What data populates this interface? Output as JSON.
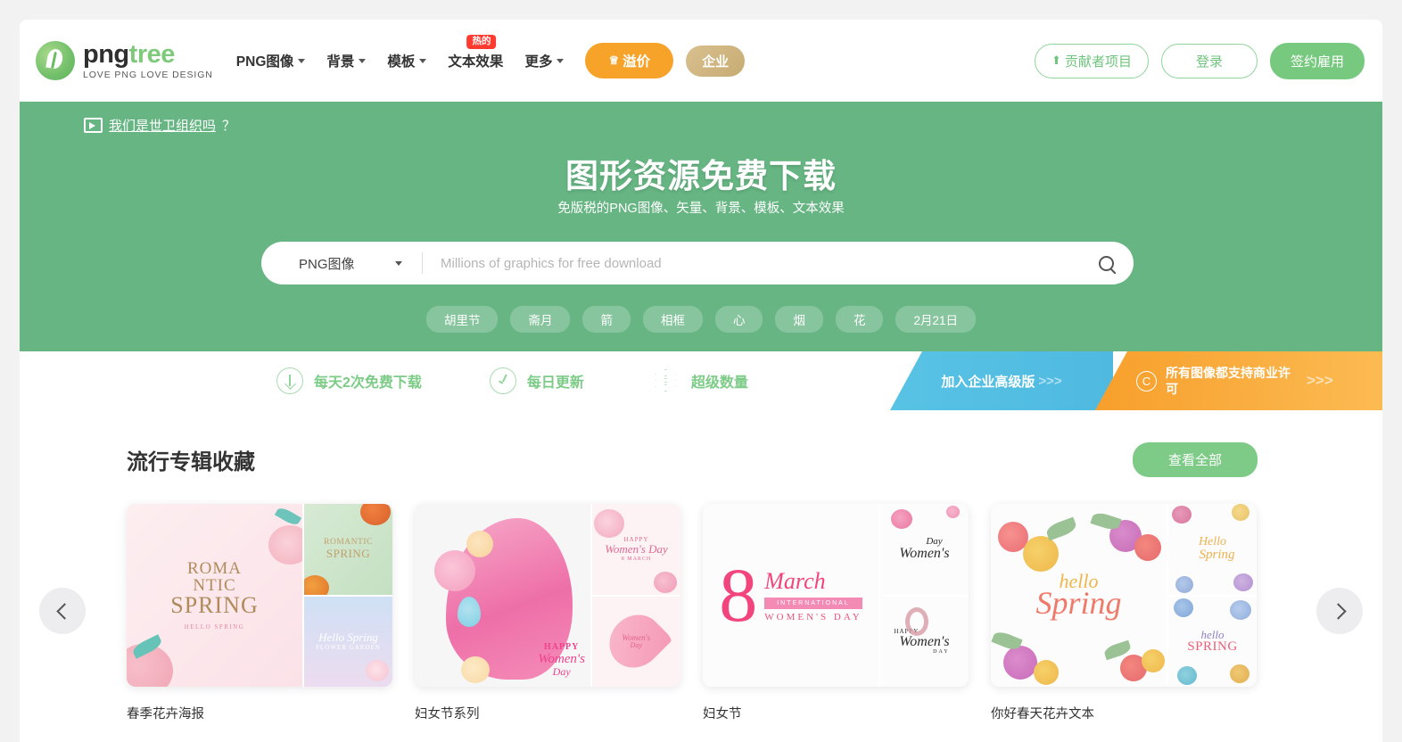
{
  "navbar": {
    "logo": {
      "png": "png",
      "tree": "tree",
      "tagline": "LOVE PNG LOVE DESIGN"
    },
    "items": [
      {
        "label": "PNG图像",
        "has_caret": true
      },
      {
        "label": "背景",
        "has_caret": true
      },
      {
        "label": "模板",
        "has_caret": true
      },
      {
        "label": "文本效果",
        "has_caret": false,
        "badge": "热的"
      },
      {
        "label": "更多",
        "has_caret": true
      }
    ],
    "premium_button": "溢价",
    "enterprise_button": "企业",
    "contributor_button": "贡献者项目",
    "login_button": "登录",
    "hire_button": "签约雇用",
    "accent_green": "#76c97e",
    "accent_orange": "#f7a229",
    "accent_gold": "#c7ab73"
  },
  "hero": {
    "who_link": "我们是世卫组织吗",
    "who_question": "？",
    "title": "图形资源免费下载",
    "subtitle": "免版税的PNG图像、矢量、背景、模板、文本效果",
    "search": {
      "category": "PNG图像",
      "placeholder": "Millions of graphics for free download",
      "value": ""
    },
    "tags": [
      "胡里节",
      "斋月",
      "箭",
      "相框",
      "心",
      "烟",
      "花",
      "2月21日"
    ],
    "background_color": "#66b583"
  },
  "strip": {
    "features": [
      {
        "icon": "download-arrow-icon",
        "label": "每天2次免费下载"
      },
      {
        "icon": "clock-icon",
        "label": "每日更新"
      },
      {
        "icon": "layers-icon",
        "label": "超级数量"
      }
    ],
    "promo_blue": {
      "label": "加入企业高级版",
      "arrows": ">>>",
      "color": "#4fb9e0"
    },
    "promo_orange": {
      "label": "所有图像都支持商业许可",
      "arrows": ">>>",
      "color": "#f79f2c",
      "icon": "copyright-icon"
    }
  },
  "collection": {
    "title": "流行专辑收藏",
    "see_all": "查看全部",
    "prev_arrow": "‹",
    "next_arrow": "›",
    "cards": [
      {
        "label": "春季花卉海报",
        "main_art": {
          "line1": "ROMA",
          "line2": "NTIC",
          "line3": "SPRING",
          "caption": "HELLO SPRING"
        },
        "side_top": {
          "line1": "ROMANTIC",
          "line2": "SPRING"
        },
        "side_bottom": {
          "line1": "Hello Spring",
          "line2": "FLOWER GARDEN"
        }
      },
      {
        "label": "妇女节系列",
        "main_art": {
          "line1": "HAPPY",
          "line2": "Women's",
          "line3": "Day"
        },
        "side_top": {
          "line1": "HAPPY",
          "line2": "Women's Day",
          "line3": "8 MARCH"
        },
        "side_bottom": {
          "line1": "Women's",
          "line2": "Day"
        }
      },
      {
        "label": "妇女节",
        "main_art": {
          "line1": "8",
          "line2": "March",
          "line3": "INTERNATIONAL",
          "line4": "WOMEN'S DAY"
        },
        "side_top": {
          "line1": "Day",
          "line2": "Women's"
        },
        "side_bottom": {
          "line1": "HAPPY",
          "line2": "Women's",
          "line3": "DAY"
        }
      },
      {
        "label": "你好春天花卉文本",
        "main_art": {
          "line1": "hello",
          "line2": "Spring"
        },
        "side_top": {
          "line1": "Hello",
          "line2": "Spring"
        },
        "side_bottom": {
          "line1": "hello",
          "line2": "SPRING"
        }
      }
    ]
  }
}
